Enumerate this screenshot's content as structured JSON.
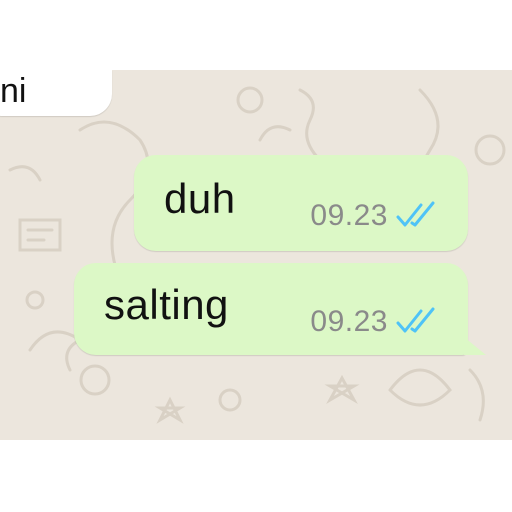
{
  "chat": {
    "incoming_partial_text": "ni",
    "messages": [
      {
        "text": "duh",
        "time": "09.23",
        "status_icon": "double-check-read-icon"
      },
      {
        "text": "salting",
        "time": "09.23",
        "status_icon": "double-check-read-icon"
      }
    ]
  },
  "colors": {
    "wallpaper": "#ece6dd",
    "outgoing_bubble": "#dcf8c6",
    "incoming_bubble": "#ffffff",
    "read_tick": "#4fc3f7",
    "time_text": "#8a8a8a"
  }
}
